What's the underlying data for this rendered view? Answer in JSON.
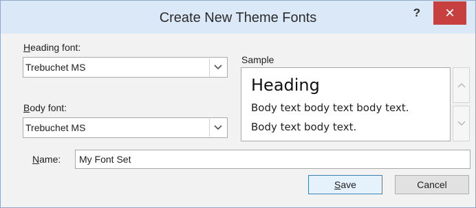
{
  "window": {
    "title": "Create New Theme Fonts",
    "help_label": "?",
    "close_label": "✕"
  },
  "heading_font": {
    "label_accel": "H",
    "label_rest": "eading font:",
    "value": "Trebuchet MS"
  },
  "body_font": {
    "label_accel": "B",
    "label_rest": "ody font:",
    "value": "Trebuchet MS"
  },
  "sample": {
    "label": "Sample",
    "heading": "Heading",
    "body_line1": "Body text body text body text.",
    "body_line2": "Body text body text."
  },
  "name": {
    "label_accel": "N",
    "label_rest": "ame:",
    "value": "My Font Set"
  },
  "buttons": {
    "save_accel": "S",
    "save_rest": "ave",
    "cancel": "Cancel"
  },
  "icons": {
    "dropdown": "chevron-down-icon",
    "scroll_up": "chevron-up-icon",
    "scroll_down": "chevron-down-icon",
    "close": "close-icon"
  },
  "colors": {
    "titlebar": "#dbe8f7",
    "close_button": "#c7403f",
    "content_bg": "#f2f2f2",
    "default_button_border": "#3c7fb1"
  }
}
